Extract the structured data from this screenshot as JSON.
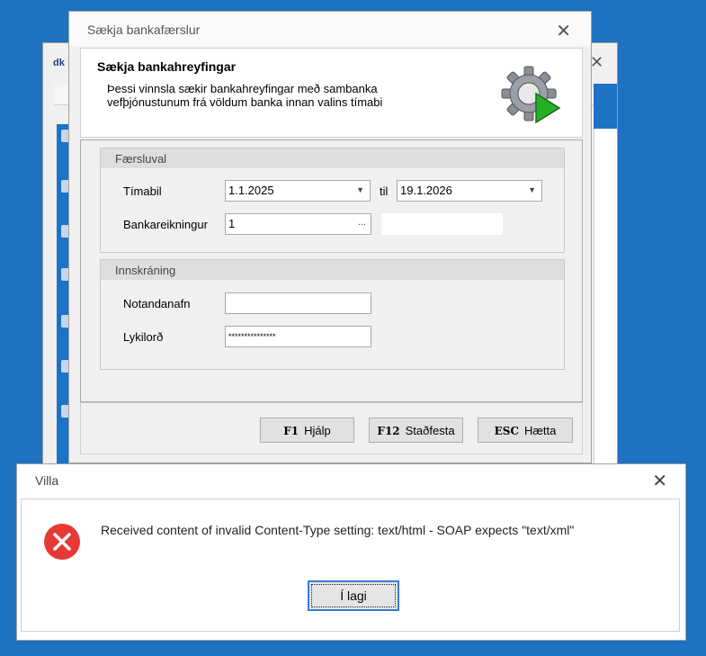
{
  "background_window": {
    "title": "dk"
  },
  "main_dialog": {
    "title": "Sækja bankafærslur",
    "header_title": "Sækja bankahreyfingar",
    "header_desc_line1": "Þessi vinnsla sækir bankahreyfingar með sambanka",
    "header_desc_line2": "vefþjónustunum frá völdum banka innan valins tímabi"
  },
  "transactions_group": {
    "title": "Færsluval",
    "period_label": "Tímabil",
    "from_date": "1.1.2025",
    "to_label": "til",
    "to_date": "19.1.2026",
    "bank_account_label": "Bankareikningur",
    "bank_account_value": "1",
    "ellipsis": "..."
  },
  "login_group": {
    "title": "Innskráning",
    "username_label": "Notandanafn",
    "username_value": "",
    "password_label": "Lykilorð",
    "password_value": "***************"
  },
  "buttons": {
    "help_key": "F1",
    "help_label": "Hjálp",
    "confirm_key": "F12",
    "confirm_label": "Staðfesta",
    "cancel_key": "ESC",
    "cancel_label": "Hætta"
  },
  "error_dialog": {
    "title": "Villa",
    "message": "Received content of invalid Content-Type setting: text/html - SOAP expects \"text/xml\"",
    "ok_label": "Í lagi"
  },
  "colors": {
    "desktop": "#1f71c2",
    "error_icon": "#e53935",
    "focus_border": "#3a7bd5"
  }
}
